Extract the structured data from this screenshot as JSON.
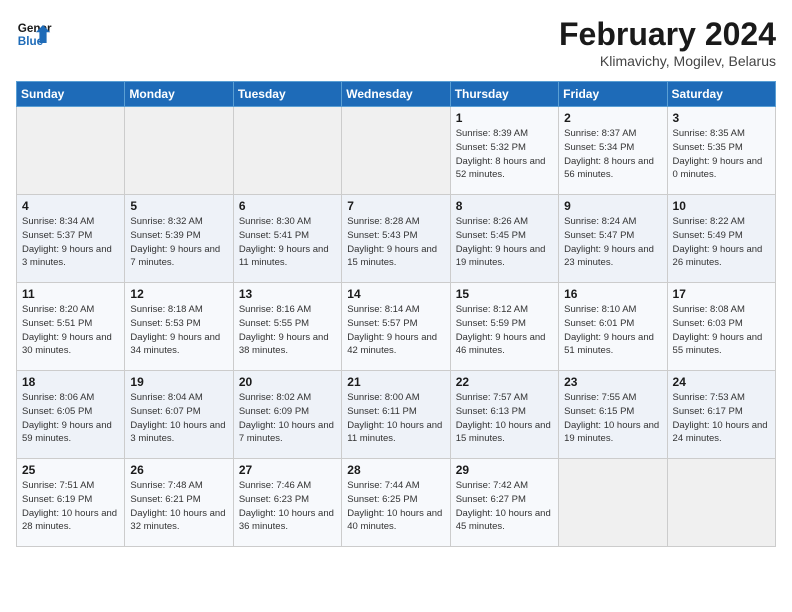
{
  "header": {
    "logo_line1": "General",
    "logo_line2": "Blue",
    "title": "February 2024",
    "subtitle": "Klimavichy, Mogilev, Belarus"
  },
  "days_of_week": [
    "Sunday",
    "Monday",
    "Tuesday",
    "Wednesday",
    "Thursday",
    "Friday",
    "Saturday"
  ],
  "weeks": [
    [
      {
        "day": "",
        "info": ""
      },
      {
        "day": "",
        "info": ""
      },
      {
        "day": "",
        "info": ""
      },
      {
        "day": "",
        "info": ""
      },
      {
        "day": "1",
        "info": "Sunrise: 8:39 AM\nSunset: 5:32 PM\nDaylight: 8 hours\nand 52 minutes."
      },
      {
        "day": "2",
        "info": "Sunrise: 8:37 AM\nSunset: 5:34 PM\nDaylight: 8 hours\nand 56 minutes."
      },
      {
        "day": "3",
        "info": "Sunrise: 8:35 AM\nSunset: 5:35 PM\nDaylight: 9 hours\nand 0 minutes."
      }
    ],
    [
      {
        "day": "4",
        "info": "Sunrise: 8:34 AM\nSunset: 5:37 PM\nDaylight: 9 hours\nand 3 minutes."
      },
      {
        "day": "5",
        "info": "Sunrise: 8:32 AM\nSunset: 5:39 PM\nDaylight: 9 hours\nand 7 minutes."
      },
      {
        "day": "6",
        "info": "Sunrise: 8:30 AM\nSunset: 5:41 PM\nDaylight: 9 hours\nand 11 minutes."
      },
      {
        "day": "7",
        "info": "Sunrise: 8:28 AM\nSunset: 5:43 PM\nDaylight: 9 hours\nand 15 minutes."
      },
      {
        "day": "8",
        "info": "Sunrise: 8:26 AM\nSunset: 5:45 PM\nDaylight: 9 hours\nand 19 minutes."
      },
      {
        "day": "9",
        "info": "Sunrise: 8:24 AM\nSunset: 5:47 PM\nDaylight: 9 hours\nand 23 minutes."
      },
      {
        "day": "10",
        "info": "Sunrise: 8:22 AM\nSunset: 5:49 PM\nDaylight: 9 hours\nand 26 minutes."
      }
    ],
    [
      {
        "day": "11",
        "info": "Sunrise: 8:20 AM\nSunset: 5:51 PM\nDaylight: 9 hours\nand 30 minutes."
      },
      {
        "day": "12",
        "info": "Sunrise: 8:18 AM\nSunset: 5:53 PM\nDaylight: 9 hours\nand 34 minutes."
      },
      {
        "day": "13",
        "info": "Sunrise: 8:16 AM\nSunset: 5:55 PM\nDaylight: 9 hours\nand 38 minutes."
      },
      {
        "day": "14",
        "info": "Sunrise: 8:14 AM\nSunset: 5:57 PM\nDaylight: 9 hours\nand 42 minutes."
      },
      {
        "day": "15",
        "info": "Sunrise: 8:12 AM\nSunset: 5:59 PM\nDaylight: 9 hours\nand 46 minutes."
      },
      {
        "day": "16",
        "info": "Sunrise: 8:10 AM\nSunset: 6:01 PM\nDaylight: 9 hours\nand 51 minutes."
      },
      {
        "day": "17",
        "info": "Sunrise: 8:08 AM\nSunset: 6:03 PM\nDaylight: 9 hours\nand 55 minutes."
      }
    ],
    [
      {
        "day": "18",
        "info": "Sunrise: 8:06 AM\nSunset: 6:05 PM\nDaylight: 9 hours\nand 59 minutes."
      },
      {
        "day": "19",
        "info": "Sunrise: 8:04 AM\nSunset: 6:07 PM\nDaylight: 10 hours\nand 3 minutes."
      },
      {
        "day": "20",
        "info": "Sunrise: 8:02 AM\nSunset: 6:09 PM\nDaylight: 10 hours\nand 7 minutes."
      },
      {
        "day": "21",
        "info": "Sunrise: 8:00 AM\nSunset: 6:11 PM\nDaylight: 10 hours\nand 11 minutes."
      },
      {
        "day": "22",
        "info": "Sunrise: 7:57 AM\nSunset: 6:13 PM\nDaylight: 10 hours\nand 15 minutes."
      },
      {
        "day": "23",
        "info": "Sunrise: 7:55 AM\nSunset: 6:15 PM\nDaylight: 10 hours\nand 19 minutes."
      },
      {
        "day": "24",
        "info": "Sunrise: 7:53 AM\nSunset: 6:17 PM\nDaylight: 10 hours\nand 24 minutes."
      }
    ],
    [
      {
        "day": "25",
        "info": "Sunrise: 7:51 AM\nSunset: 6:19 PM\nDaylight: 10 hours\nand 28 minutes."
      },
      {
        "day": "26",
        "info": "Sunrise: 7:48 AM\nSunset: 6:21 PM\nDaylight: 10 hours\nand 32 minutes."
      },
      {
        "day": "27",
        "info": "Sunrise: 7:46 AM\nSunset: 6:23 PM\nDaylight: 10 hours\nand 36 minutes."
      },
      {
        "day": "28",
        "info": "Sunrise: 7:44 AM\nSunset: 6:25 PM\nDaylight: 10 hours\nand 40 minutes."
      },
      {
        "day": "29",
        "info": "Sunrise: 7:42 AM\nSunset: 6:27 PM\nDaylight: 10 hours\nand 45 minutes."
      },
      {
        "day": "",
        "info": ""
      },
      {
        "day": "",
        "info": ""
      }
    ]
  ]
}
